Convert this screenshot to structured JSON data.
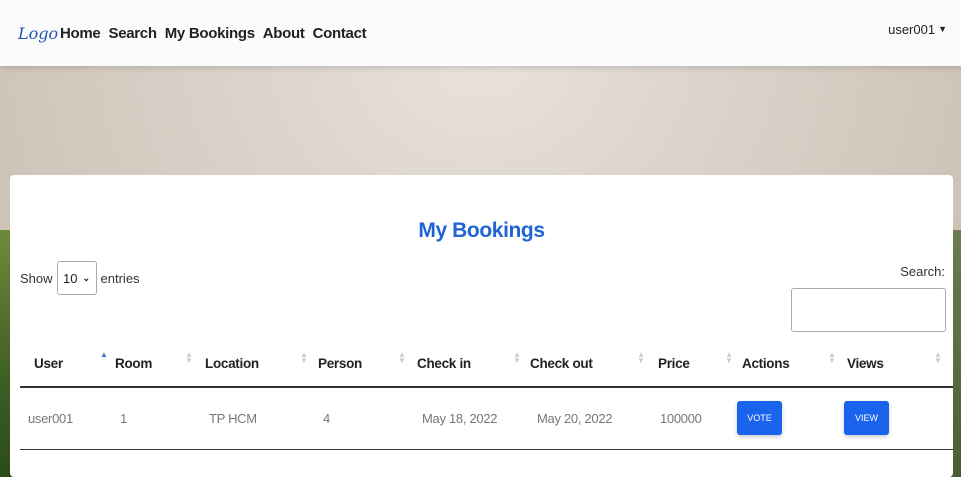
{
  "nav": {
    "logo": "Logo",
    "links": [
      "Home",
      "Search",
      "My Bookings",
      "About",
      "Contact"
    ],
    "user": "user001"
  },
  "page_title": "My Bookings",
  "table_controls": {
    "show_label": "Show",
    "entries_value": "10",
    "entries_label": "entries",
    "search_label": "Search:"
  },
  "table": {
    "headers": [
      "User",
      "Room",
      "Location",
      "Person",
      "Check in",
      "Check out",
      "Price",
      "Actions",
      "Views"
    ],
    "rows": [
      {
        "user": "user001",
        "room": "1",
        "location": "TP HCM",
        "person": "4",
        "check_in": "May 18, 2022",
        "check_out": "May 20, 2022",
        "price": "100000",
        "action_label": "VOTE",
        "view_label": "VIEW"
      }
    ]
  },
  "colors": {
    "accent": "#1f63d6",
    "button": "#1a63ec"
  }
}
